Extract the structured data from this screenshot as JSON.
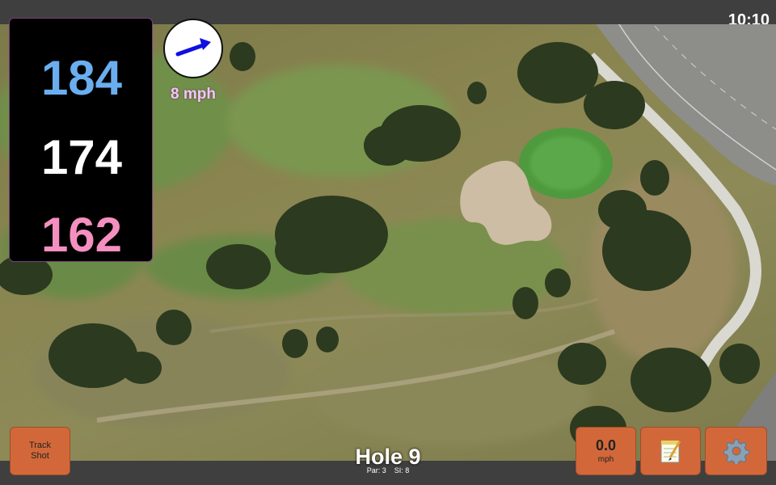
{
  "status": {
    "time": "10:10"
  },
  "yardages": {
    "back": "184",
    "center": "174",
    "front": "162"
  },
  "wind": {
    "speed_label": "8 mph",
    "icon": "wind-direction-arrow-icon"
  },
  "buttons": {
    "track_shot": {
      "line1": "Track",
      "line2": "Shot"
    },
    "speed": {
      "value": "0.0",
      "unit": "mph"
    },
    "notes_icon": "notepad-icon",
    "settings_icon": "gear-icon"
  },
  "hole": {
    "title": "Hole 9",
    "par_label": "Par:",
    "par": "3",
    "si_label": "SI:",
    "si": "8"
  },
  "colors": {
    "back": "#6aaef0",
    "center": "#ffffff",
    "front": "#f58fc0",
    "accent": "#d2683a"
  }
}
